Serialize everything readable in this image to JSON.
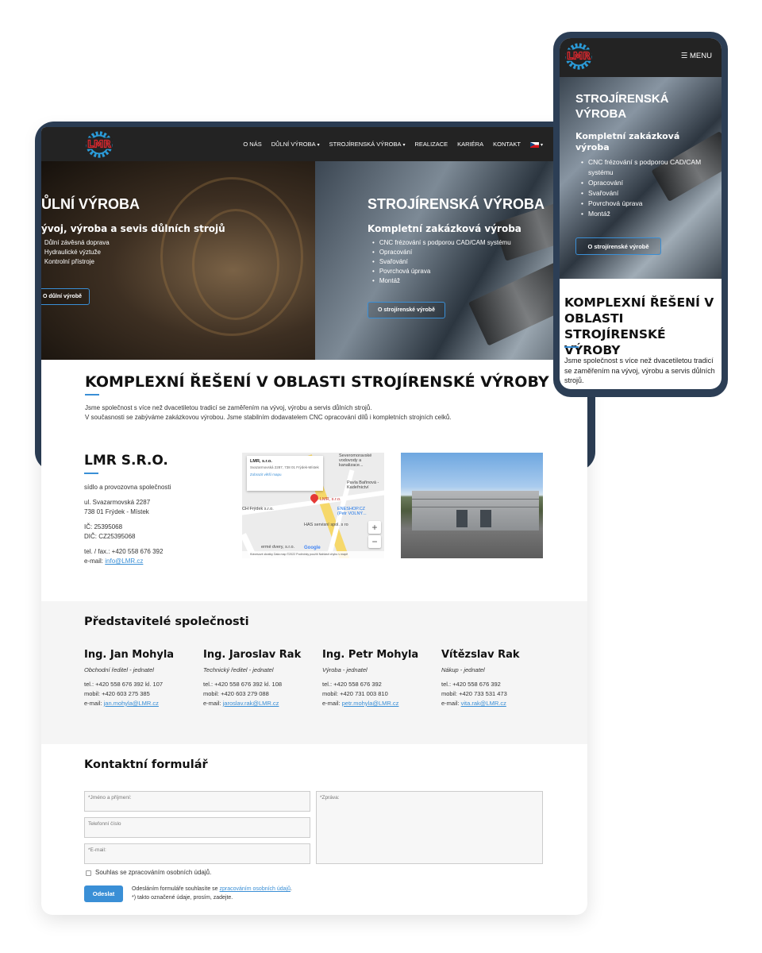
{
  "desktop": {
    "nav": {
      "items": [
        {
          "label": "O NÁS",
          "dropdown": false
        },
        {
          "label": "DŮLNÍ VÝROBA",
          "dropdown": true
        },
        {
          "label": "STROJÍRENSKÁ VÝROBA",
          "dropdown": true
        },
        {
          "label": "REALIZACE",
          "dropdown": false
        },
        {
          "label": "KARIÉRA",
          "dropdown": false
        },
        {
          "label": "KONTAKT",
          "dropdown": false
        }
      ],
      "language_icon": "czech-flag-icon"
    },
    "hero_left": {
      "title": "ŮLNÍ VÝROBA",
      "subtitle": "ývoj, výroba a sevis důlních strojů",
      "items": [
        "Důlní závěsná doprava",
        "Hydraulické výztuže",
        "Kontrolní přístroje"
      ],
      "button": "O důlní výrobě"
    },
    "hero_right": {
      "title": "STROJÍRENSKÁ VÝROBA",
      "subtitle": "Kompletní zakázková výroba",
      "items": [
        "CNC frézování s podporou CAD/CAM systému",
        "Opracování",
        "Svařování",
        "Povrchová úprava",
        "Montáž"
      ],
      "button": "O strojírenské výrobě"
    },
    "main": {
      "title": "KOMPLEXNÍ ŘEŠENÍ V OBLASTI STROJÍRENSKÉ VÝROBY",
      "line1": "Jsme společnost s více než dvacetiletou tradicí se zaměřením na vývoj, výrobu a servis důlních strojů.",
      "line2": "V současnosti se zabýváme zakázkovou výrobou. Jsme stabilním dodavatelem CNC opracování dílů i kompletních strojních celků."
    },
    "company": {
      "title": "LMR S.R.O.",
      "seat": "sídlo a provozovna společnosti",
      "street": "ul. Svazarmovská 2287",
      "city": "738 01  Frýdek - Místek",
      "ic": "IČ: 25395068",
      "dic": "DIČ: CZ25395068",
      "phone": "tel. / fax.: +420 558 676 392",
      "email_label": "e-mail:",
      "email": "info@LMR.cz"
    },
    "map": {
      "card_title": "LMR, s.r.o.",
      "card_address": "Svazarmovská 2287, 738 01 Frýdek-Místek",
      "card_link": "Zobrazit větší mapu",
      "labels": [
        "Severomoravské vodovody a kanalizace...",
        "Pavla Bařinová - Kadeřnictví",
        "LMR, s.r.o.",
        "ENESHOP.CZ (Petr VOLNÝ...",
        "HAS servisní spol. s ro",
        "CH Frýdek s.r.o.",
        "ermé dvery, s.r.o."
      ],
      "zoom_in": "+",
      "zoom_out": "−",
      "logo": "Google",
      "footer": "Klávesové zkratky   Data map ©2022   Podmínky použití   Nahlásit chybu v mapě"
    },
    "representatives": {
      "title": "Představitelé společnosti",
      "people": [
        {
          "name": "Ing. Jan Mohyla",
          "role": "Obchodní ředitel - jednatel",
          "tel": "tel.: +420 558 676  392  kl. 107",
          "mobile": "mobil: +420 603 275 385",
          "email_label": "e-mail:",
          "email": "jan.mohyla@LMR.cz"
        },
        {
          "name": "Ing. Jaroslav Rak",
          "role": "Technický ředitel - jednatel",
          "tel": "tel.: +420 558 676  392  kl. 108",
          "mobile": "mobil: +420 603 279 088",
          "email_label": "e-mail:",
          "email": "jaroslav.rak@LMR.cz"
        },
        {
          "name": "Ing. Petr Mohyla",
          "role": "Výroba - jednatel",
          "tel": "tel.: +420 558 676 392",
          "mobile": "mobil: +420 731 003 810",
          "email_label": "e-mail:",
          "email": "petr.mohyla@LMR.cz"
        },
        {
          "name": "Vítězslav Rak",
          "role": "Nákup - jednatel",
          "tel": "tel.: +420 558 676 392",
          "mobile": "mobil: +420 733 531 473",
          "email_label": "e-mail:",
          "email": "vita.rak@LMR.cz"
        }
      ]
    },
    "form": {
      "title": "Kontaktní formulář",
      "name_placeholder": "*Jméno a příjmení:",
      "phone_placeholder": "Telefonní číslo",
      "email_placeholder": "*E-mail:",
      "message_placeholder": "*Zpráva:",
      "consent": "Souhlas se zpracováním osobních údajů.",
      "submit": "Odeslat",
      "note_prefix": "Odesláním formuláře souhlasíte se",
      "note_link": "zpracováním osobních údajů",
      "note_suffix": ".",
      "note_required": "*) takto označené údaje, prosím, zadejte."
    }
  },
  "mobile": {
    "menu": "MENU",
    "hero": {
      "title": "STROJÍRENSKÁ VÝROBA",
      "subtitle": "Kompletní zakázková výroba",
      "items": [
        "CNC frézování s podporou CAD/CAM systému",
        "Opracování",
        "Svařování",
        "Povrchová úprava",
        "Montáž"
      ],
      "button": "O strojírenské výrobě"
    },
    "title": "KOMPLEXNÍ ŘEŠENÍ V OBLASTI STROJÍRENSKÉ VÝROBY",
    "text": "Jsme společnost s více než dvacetiletou tradicí se zaměřením na vývoj, výrobu a servis důlních strojů."
  },
  "colors": {
    "accent": "#3a8fd6",
    "frame": "#2c3e55",
    "nav": "#232323",
    "logo_red": "#d6282e",
    "logo_gear": "#2b9bd8"
  }
}
